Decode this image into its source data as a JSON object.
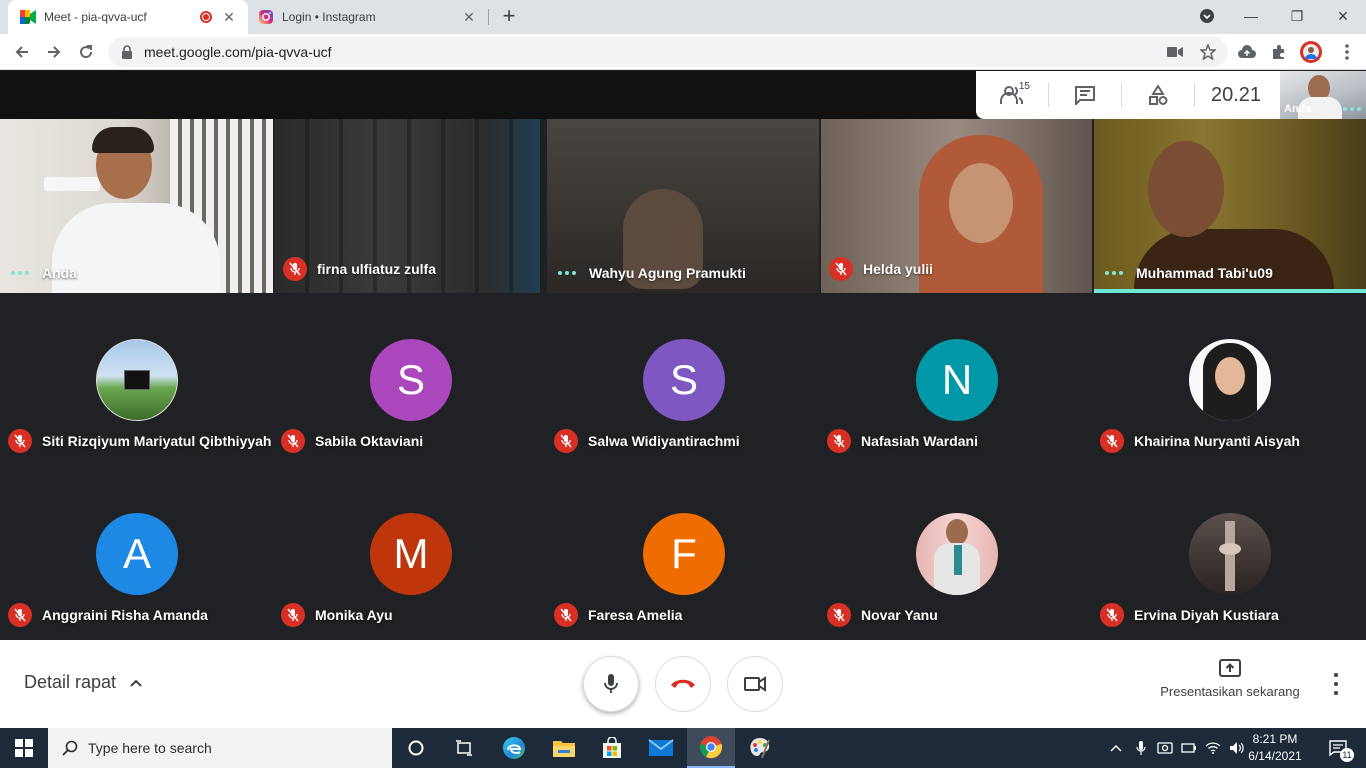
{
  "browser": {
    "tabs": [
      {
        "title": "Meet - pia-qvva-ucf",
        "active": true
      },
      {
        "title": "Login • Instagram",
        "active": false
      }
    ],
    "url": "meet.google.com/pia-qvva-ucf"
  },
  "meet": {
    "participant_count": "15",
    "time": "20.21",
    "self_name": "Anda",
    "video_tiles": [
      {
        "name": "Anda",
        "status": "speaking"
      },
      {
        "name": "firna ulfiatuz zulfa",
        "status": "muted"
      },
      {
        "name": "Wahyu Agung Pramukti",
        "status": "speaking"
      },
      {
        "name": "Helda yulii",
        "status": "muted"
      },
      {
        "name": "Muhammad Tabi'u09",
        "status": "speaking"
      }
    ],
    "avatar_tiles": [
      {
        "name": "Siti Rizqiyum Mariyatul Qibthiyyah",
        "initial": "",
        "color": "#6aa84f"
      },
      {
        "name": "Sabila Oktaviani",
        "initial": "S",
        "color": "#ab47bc"
      },
      {
        "name": "Salwa Widiyantirachmi",
        "initial": "S",
        "color": "#7e57c2"
      },
      {
        "name": "Nafasiah Wardani",
        "initial": "N",
        "color": "#0097a7"
      },
      {
        "name": "Khairina Nuryanti Aisyah",
        "initial": "",
        "color": "#f5f5f5"
      },
      {
        "name": "Anggraini Risha Amanda",
        "initial": "A",
        "color": "#1e88e5"
      },
      {
        "name": "Monika Ayu",
        "initial": "M",
        "color": "#bf360c"
      },
      {
        "name": "Faresa Amelia",
        "initial": "F",
        "color": "#ef6c00"
      },
      {
        "name": "Novar Yanu",
        "initial": "",
        "color": "#e8b8b8"
      },
      {
        "name": "Ervina Diyah Kustiara",
        "initial": "",
        "color": "#4e4542"
      }
    ],
    "bottom": {
      "details_label": "Detail rapat",
      "present_label": "Presentasikan sekarang"
    }
  },
  "taskbar": {
    "search_placeholder": "Type here to search",
    "time": "8:21 PM",
    "date": "6/14/2021",
    "notification_count": "11"
  }
}
